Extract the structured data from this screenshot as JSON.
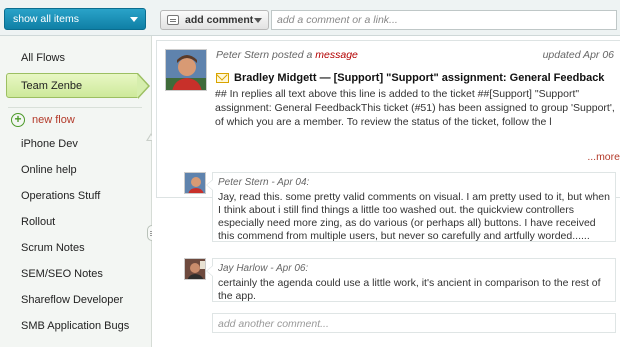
{
  "toolbar": {
    "filter_label": "show all items",
    "add_comment_label": "add comment",
    "comment_placeholder": "add a comment or a link..."
  },
  "sidebar": {
    "items": [
      {
        "label": "All Flows"
      },
      {
        "label": "Team Zenbe",
        "active": true
      }
    ],
    "new_flow_label": "new flow",
    "flows": [
      {
        "label": "iPhone Dev"
      },
      {
        "label": "Online help"
      },
      {
        "label": "Operations Stuff"
      },
      {
        "label": "Rollout"
      },
      {
        "label": "Scrum Notes"
      },
      {
        "label": "SEM/SEO Notes"
      },
      {
        "label": "Shareflow Developer"
      },
      {
        "label": "SMB Application Bugs"
      }
    ]
  },
  "post": {
    "author": "Peter Stern",
    "action": "posted a",
    "type_link": "message",
    "updated": "updated Apr 06",
    "title": "Bradley Midgett — [Support] \"Support\" assignment: General Feedback",
    "body": "## In replies all text above this line is added to the ticket ##[Support] \"Support\" assignment: General FeedbackThis ticket (#51) has been assigned to group 'Support', of which you are a member. To review the status of the ticket, follow the l",
    "more": "...more"
  },
  "comments": [
    {
      "meta": "Peter Stern - Apr 04:",
      "body": "Jay, read this. some pretty valid comments on visual. I am pretty used to it, but when I think about i still find things a little too washed out. the quickview controllers especially need more zing, as do various (or perhaps all) buttons. I have received this commend from multiple users, but never so carefully and artfully worded......"
    },
    {
      "meta": "Jay Harlow - Apr 06:",
      "body": "certainly the agenda could use a little work, it's ancient in comparison to the rest of the app."
    }
  ],
  "another_placeholder": "add another comment...",
  "colors": {
    "accent_blue": "#0f7fa5",
    "active_green": "#cde99a",
    "link_red": "#b30000"
  }
}
